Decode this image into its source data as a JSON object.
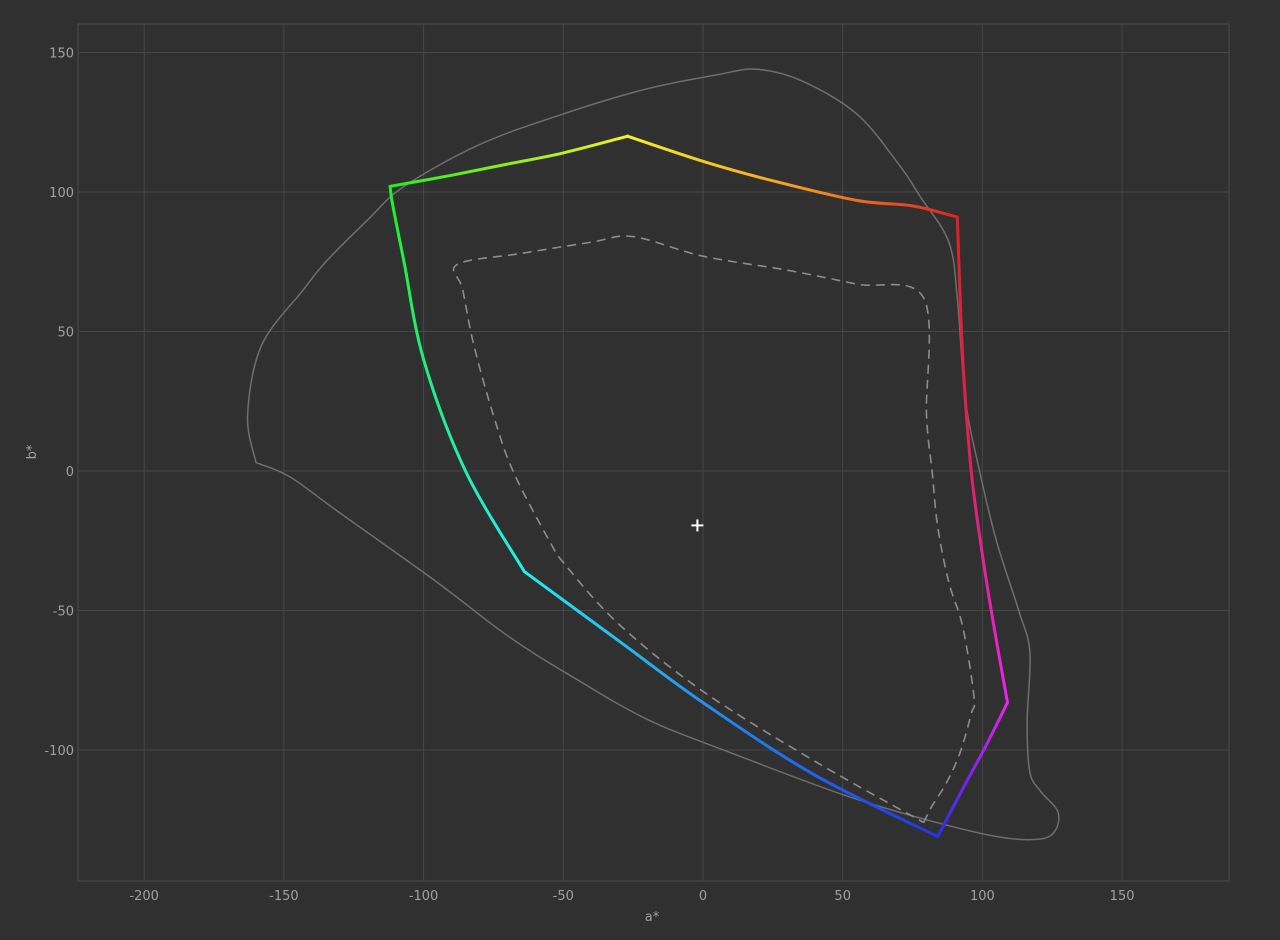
{
  "chart_data": {
    "type": "line",
    "xlabel": "a*",
    "ylabel": "b*",
    "xlim": [
      -225,
      188
    ],
    "ylim": [
      -147,
      160
    ],
    "x_ticks": [
      -200,
      -150,
      -100,
      -50,
      0,
      50,
      100,
      150
    ],
    "y_ticks": [
      150,
      100,
      50,
      0,
      -50,
      -100
    ],
    "x_tick_labels": [
      "-200",
      "-150",
      "-100",
      "-50",
      "0",
      "50",
      "100",
      "150"
    ],
    "y_tick_labels": [
      "150",
      "100",
      "50",
      "0",
      "-50",
      "-100"
    ],
    "grid": true,
    "white_point": {
      "a": -2,
      "b": -19.5,
      "marker": "plus"
    },
    "colors": {
      "background": "#303030",
      "grid": "#464646",
      "frame": "#4c4c4c",
      "outline": "#6e6e6e",
      "dashed": "#8c8c8c",
      "tick_label": "#a0a0a0",
      "white_point": "#ffffff"
    },
    "series": [
      {
        "style": "solid-thin",
        "points": [
          [
            -160,
            3
          ],
          [
            -163,
            20
          ],
          [
            -158,
            45
          ],
          [
            -143,
            65
          ],
          [
            -135,
            75
          ],
          [
            -120,
            90
          ],
          [
            -107,
            102
          ],
          [
            -80,
            117
          ],
          [
            -50,
            128
          ],
          [
            -20,
            137
          ],
          [
            5,
            142
          ],
          [
            19,
            144
          ],
          [
            35,
            140
          ],
          [
            55,
            128
          ],
          [
            70,
            110
          ],
          [
            78,
            98
          ],
          [
            88,
            82
          ],
          [
            91,
            62
          ],
          [
            94,
            25
          ],
          [
            99,
            0
          ],
          [
            105,
            -25
          ],
          [
            113,
            -50
          ],
          [
            117,
            -65
          ],
          [
            116,
            -90
          ],
          [
            117,
            -108
          ],
          [
            121,
            -115
          ],
          [
            127,
            -122
          ],
          [
            126,
            -129
          ],
          [
            120,
            -132
          ],
          [
            105,
            -131
          ],
          [
            80,
            -125
          ],
          [
            50,
            -116
          ],
          [
            10,
            -101
          ],
          [
            -20,
            -89
          ],
          [
            -48,
            -73
          ],
          [
            -70,
            -59
          ],
          [
            -95,
            -40
          ],
          [
            -130,
            -15
          ],
          [
            -148,
            -2
          ],
          [
            -160,
            3
          ]
        ]
      },
      {
        "style": "gradient",
        "closed": true,
        "vertices": [
          {
            "a": -112,
            "b": 102,
            "color": "#22ee22"
          },
          {
            "a": -27,
            "b": 120,
            "color": "#f5f026"
          },
          {
            "a": 91,
            "b": 91,
            "color": "#dd2222"
          },
          {
            "a": 109,
            "b": -83,
            "color": "#ee22ee"
          },
          {
            "a": 84,
            "b": -131,
            "color": "#2233ee"
          },
          {
            "a": -64,
            "b": -36,
            "color": "#22eeee"
          }
        ],
        "edges": [
          {
            "color_stops": [
              "#22ee22",
              "#88ee22",
              "#f5f026"
            ],
            "points": [
              [
                -112,
                102
              ],
              [
                -90,
                106
              ],
              [
                -70,
                110
              ],
              [
                -50,
                114
              ],
              [
                -27,
                120
              ]
            ]
          },
          {
            "color_stops": [
              "#f5f026",
              "#f5a020",
              "#dd2222"
            ],
            "points": [
              [
                -27,
                120
              ],
              [
                0,
                111
              ],
              [
                25,
                104
              ],
              [
                55,
                97
              ],
              [
                75,
                95
              ],
              [
                91,
                91
              ]
            ]
          },
          {
            "color_stops": [
              "#dd2222",
              "#e0205e",
              "#ee22ee"
            ],
            "points": [
              [
                91,
                91
              ],
              [
                93,
                40
              ],
              [
                96,
                0
              ],
              [
                100,
                -30
              ],
              [
                104,
                -55
              ],
              [
                109,
                -83
              ]
            ]
          },
          {
            "color_stops": [
              "#ee22ee",
              "#8822ee",
              "#2233ee"
            ],
            "points": [
              [
                109,
                -83
              ],
              [
                101,
                -99
              ],
              [
                94,
                -112
              ],
              [
                84,
                -131
              ]
            ]
          },
          {
            "color_stops": [
              "#2233ee",
              "#2288ee",
              "#22eeee"
            ],
            "points": [
              [
                84,
                -131
              ],
              [
                40,
                -109
              ],
              [
                0,
                -83
              ],
              [
                -30,
                -61
              ],
              [
                -64,
                -36
              ]
            ]
          },
          {
            "color_stops": [
              "#22eeee",
              "#22ee88",
              "#22ee22"
            ],
            "points": [
              [
                -64,
                -36
              ],
              [
                -85,
                0
              ],
              [
                -100,
                40
              ],
              [
                -107,
                75
              ],
              [
                -111,
                95
              ],
              [
                -112,
                102
              ]
            ]
          }
        ]
      },
      {
        "style": "dashed",
        "points": [
          [
            79,
            -126
          ],
          [
            82,
            -120
          ],
          [
            87,
            -112
          ],
          [
            92,
            -101
          ],
          [
            96,
            -87
          ],
          [
            97,
            -81
          ],
          [
            93,
            -56
          ],
          [
            88,
            -40
          ],
          [
            84,
            -20
          ],
          [
            82,
            0
          ],
          [
            80,
            20
          ],
          [
            79,
            62
          ],
          [
            55,
            67
          ],
          [
            30,
            72
          ],
          [
            0,
            77
          ],
          [
            -25,
            84
          ],
          [
            -40,
            82
          ],
          [
            -65,
            78
          ],
          [
            -88,
            74
          ],
          [
            -86,
            65
          ],
          [
            -82,
            45
          ],
          [
            -75,
            20
          ],
          [
            -68,
            0
          ],
          [
            -55,
            -25
          ],
          [
            -49,
            -34
          ],
          [
            -30,
            -55
          ],
          [
            0,
            -79
          ],
          [
            40,
            -104
          ],
          [
            79,
            -126
          ]
        ]
      }
    ]
  }
}
